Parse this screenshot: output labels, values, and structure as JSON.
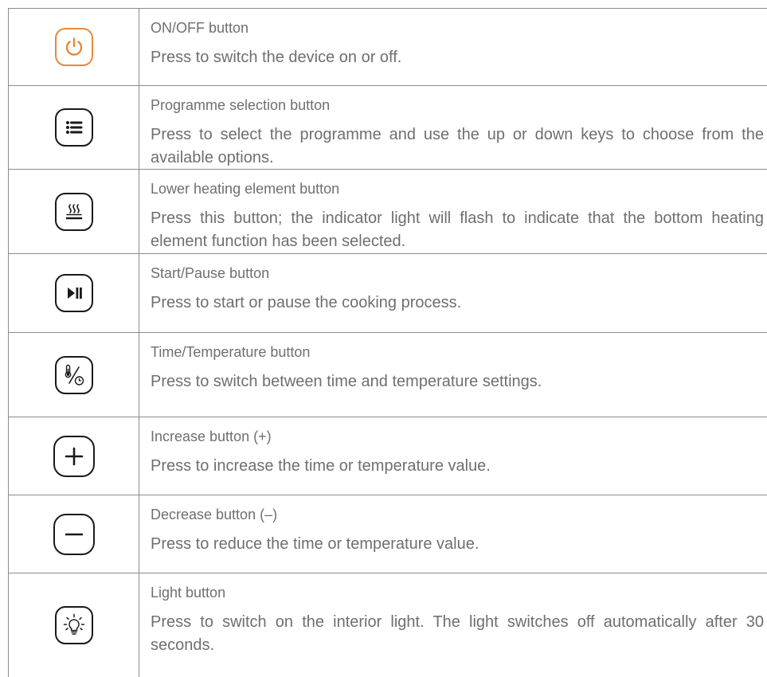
{
  "rows": [
    {
      "icon": "power-icon",
      "title": "ON/OFF button",
      "desc": "Press to switch the device on or off."
    },
    {
      "icon": "menu-list-icon",
      "title": "Programme selection button",
      "desc": "Press to select the programme and use the up or down keys to choose from the available options."
    },
    {
      "icon": "lower-heating-element-icon",
      "title": "Lower heating element button",
      "desc": "Press this button; the indicator light will flash to indicate that the bottom heating element function has been selected."
    },
    {
      "icon": "play-pause-icon",
      "title": "Start/Pause button",
      "desc": "Press to start or pause the cooking process."
    },
    {
      "icon": "time-temperature-icon",
      "title": "Time/Temperature button",
      "desc": "Press to switch between time and temperature settings."
    },
    {
      "icon": "plus-icon",
      "title": "Increase button (+)",
      "desc": "Press to increase the time or temperature value."
    },
    {
      "icon": "minus-icon",
      "title": "Decrease button (–)",
      "desc": "Press to reduce the time or temperature value."
    },
    {
      "icon": "light-bulb-icon",
      "title": "Light button",
      "desc": "Press to switch on the interior light. The light switches off automatically after 30 seconds."
    }
  ],
  "colors": {
    "power_accent": "#e8893c",
    "icon_stroke": "#1a1a1a",
    "text": "#6f6f6f",
    "border": "#8c8c8c"
  }
}
